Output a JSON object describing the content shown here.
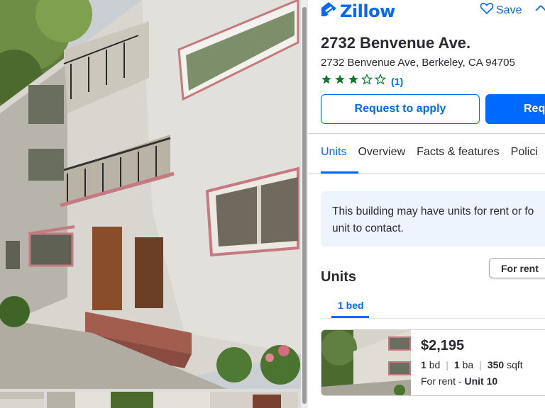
{
  "header": {
    "logo_text": "Zillow",
    "save_label": "Save",
    "brand_color": "#006aff",
    "icons": [
      "zillow-logo-icon",
      "heart-icon"
    ]
  },
  "listing": {
    "title": "2732 Benvenue Ave.",
    "address": "2732 Benvenue Ave, Berkeley, CA 94705",
    "rating_stars": 3,
    "rating_max": 5,
    "rating_count": "(1)",
    "star_color": "#0d7a2f"
  },
  "actions": {
    "apply_label": "Request to apply",
    "request_label": "Req"
  },
  "tabs": [
    {
      "label": "Units",
      "active": true
    },
    {
      "label": "Overview",
      "active": false
    },
    {
      "label": "Facts & features",
      "active": false
    },
    {
      "label": "Polici",
      "active": false
    }
  ],
  "notice": {
    "line1": "This building may have units for rent or fo",
    "line2": "unit to contact."
  },
  "units": {
    "title": "Units",
    "filter_label": "For rent",
    "bed_tab": "1 bed",
    "card": {
      "price": "$2,195",
      "beds_value": "1",
      "beds_unit": "bd",
      "baths_value": "1",
      "baths_unit": "ba",
      "sqft_value": "350",
      "sqft_unit": "sqft",
      "status_label": "For rent - ",
      "unit_name": "Unit 10"
    }
  }
}
